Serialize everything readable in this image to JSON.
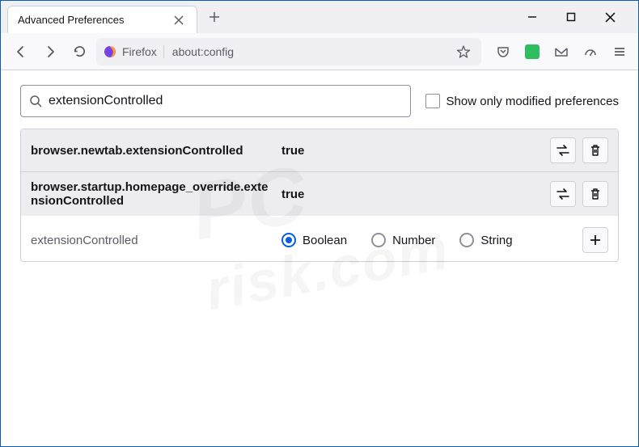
{
  "tab": {
    "title": "Advanced Preferences"
  },
  "urlbar": {
    "brand": "Firefox",
    "url": "about:config"
  },
  "search": {
    "value": "extensionControlled",
    "filter_label": "Show only modified preferences"
  },
  "prefs": {
    "rows": [
      {
        "name": "browser.newtab.extensionControlled",
        "value": "true"
      },
      {
        "name": "browser.startup.homepage_override.extensionControlled",
        "value": "true"
      }
    ],
    "new_pref": {
      "name": "extensionControlled",
      "types": {
        "boolean": "Boolean",
        "number": "Number",
        "string": "String"
      }
    }
  },
  "watermark": {
    "line1": "PC",
    "line2": "risk.com"
  }
}
